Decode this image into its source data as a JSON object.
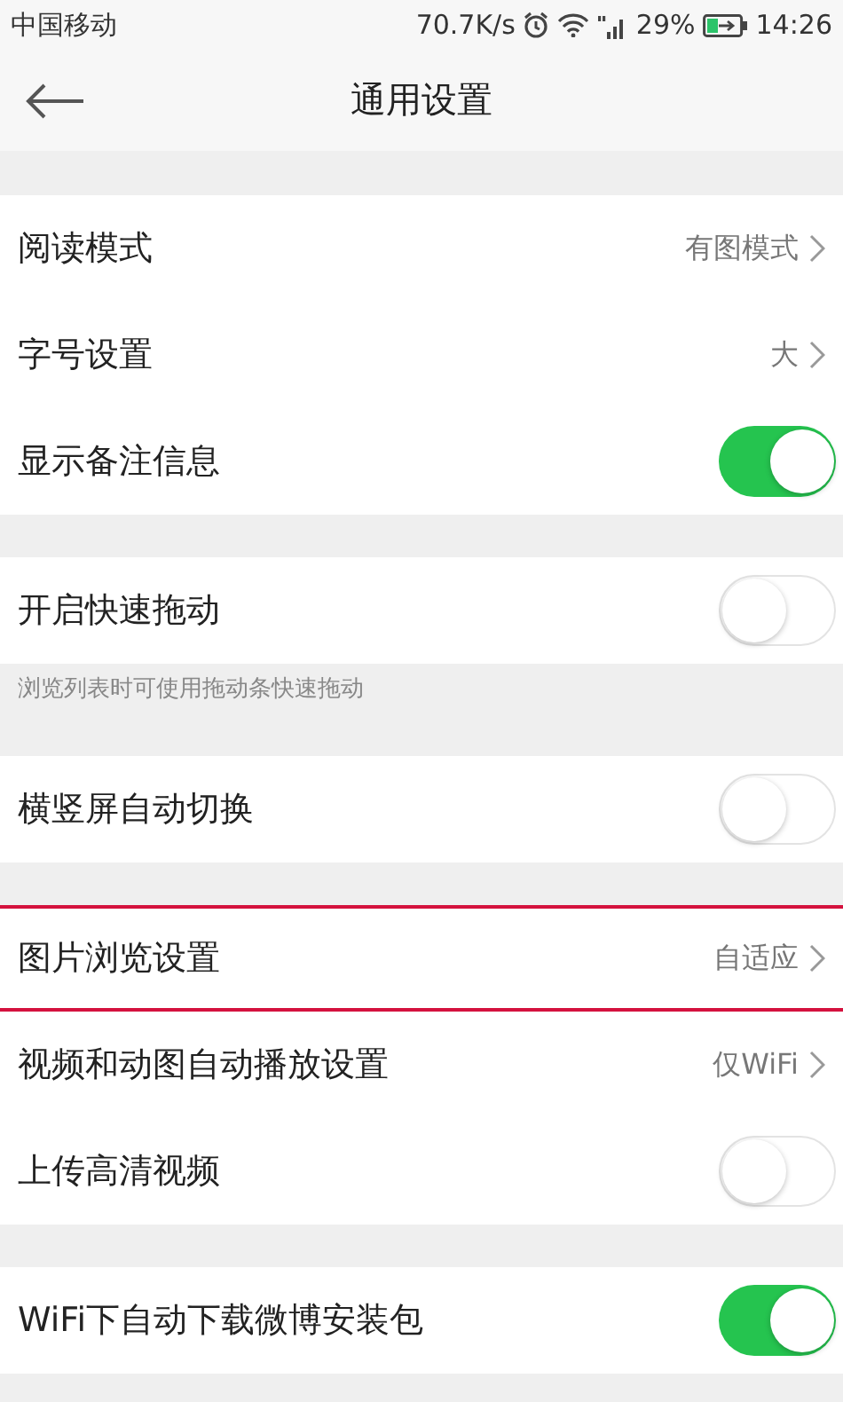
{
  "status_bar": {
    "carrier": "中国移动",
    "speed": "70.7K/s",
    "battery": "29%",
    "time": "14:26"
  },
  "header": {
    "title": "通用设置"
  },
  "sections": [
    {
      "rows": [
        {
          "kind": "link",
          "label": "阅读模式",
          "value": "有图模式",
          "highlighted": false
        },
        {
          "kind": "link",
          "label": "字号设置",
          "value": "大",
          "highlighted": false
        },
        {
          "kind": "toggle",
          "label": "显示备注信息",
          "on": true,
          "highlighted": false
        }
      ]
    },
    {
      "rows": [
        {
          "kind": "toggle",
          "label": "开启快速拖动",
          "on": false,
          "highlighted": false
        }
      ],
      "hint": "浏览列表时可使用拖动条快速拖动"
    },
    {
      "rows": [
        {
          "kind": "toggle",
          "label": "横竖屏自动切换",
          "on": false,
          "highlighted": false
        }
      ]
    },
    {
      "rows": [
        {
          "kind": "link",
          "label": "图片浏览设置",
          "value": "自适应",
          "highlighted": true
        },
        {
          "kind": "link",
          "label": "视频和动图自动播放设置",
          "value": "仅WiFi",
          "highlighted": false
        },
        {
          "kind": "toggle",
          "label": "上传高清视频",
          "on": false,
          "highlighted": false
        }
      ]
    },
    {
      "rows": [
        {
          "kind": "toggle",
          "label": "WiFi下自动下载微博安装包",
          "on": true,
          "highlighted": false
        }
      ]
    }
  ]
}
